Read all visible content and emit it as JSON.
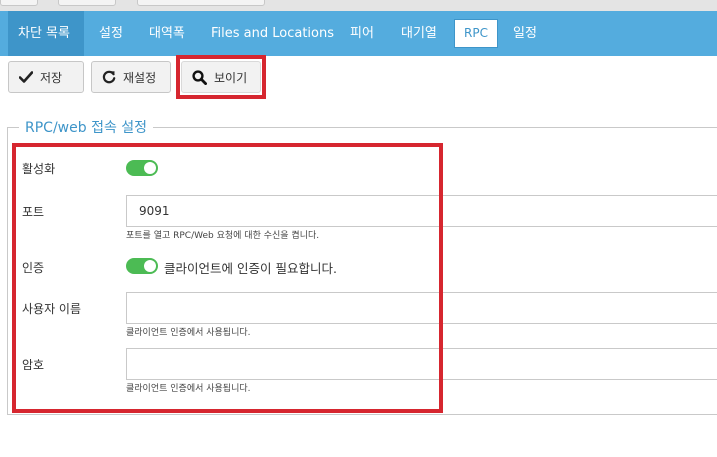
{
  "tabs": [
    {
      "label": "차단 목록",
      "state": "active"
    },
    {
      "label": "설정",
      "state": "normal"
    },
    {
      "label": "대역폭",
      "state": "normal"
    },
    {
      "label": "Files and Locations",
      "state": "normal"
    },
    {
      "label": "피어",
      "state": "normal"
    },
    {
      "label": "대기열",
      "state": "normal"
    },
    {
      "label": "RPC",
      "state": "selected"
    },
    {
      "label": "일정",
      "state": "normal"
    }
  ],
  "toolbar": {
    "save_label": "저장",
    "reset_label": "재설정",
    "view_label": "보이기"
  },
  "section": {
    "legend": "RPC/web 접속 설정",
    "enable": {
      "label": "활성화",
      "value": true
    },
    "port": {
      "label": "포트",
      "value": "9091",
      "help": "포트를 열고 RPC/Web 요청에 대한 수신을 켭니다."
    },
    "auth": {
      "label": "인증",
      "value": true,
      "text": "클라이언트에 인증이 필요합니다."
    },
    "username": {
      "label": "사용자 이름",
      "value": "",
      "help": "클라이언트 인증에서 사용됩니다."
    },
    "password": {
      "label": "암호",
      "value": "",
      "help": "클라이언트 인증에서 사용됩니다."
    }
  },
  "colors": {
    "tab_bar": "#54acde",
    "tab_active": "#3e95c9",
    "toggle_on": "#4cbb54",
    "highlight": "#d6262f",
    "legend": "#3e95c9"
  },
  "icons": {
    "save": "checkmark-icon",
    "reset": "refresh-icon",
    "view": "search-icon"
  }
}
